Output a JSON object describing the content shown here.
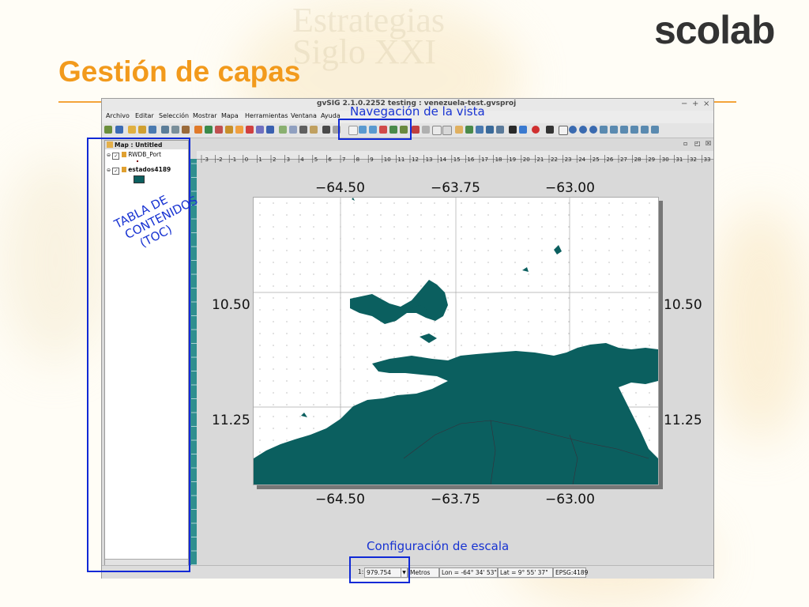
{
  "slide": {
    "title": "Gestión de capas",
    "watermark_text": "Estrategias Siglo XXI",
    "logo_text": "scolab"
  },
  "app": {
    "window_title": "gvSIG 2.1.0.2252 testing : venezuela-test.gvsproj",
    "window_controls": [
      "−",
      "+",
      "×"
    ],
    "menu": [
      "Archivo",
      "Editar",
      "Selección",
      "Mostrar",
      "Mapa",
      "Herramientas",
      "Ventana",
      "Ayuda"
    ]
  },
  "toc": {
    "title": "Map : Untitled",
    "layers": [
      {
        "name": "RWDB_Port",
        "checked": true
      },
      {
        "name": "estados4189",
        "checked": true
      }
    ],
    "legend_color": "#0b5f5f"
  },
  "view": {
    "ruler_ticks": [
      "-3",
      "-2",
      "-1",
      "0",
      "1",
      "2",
      "3",
      "4",
      "5",
      "6",
      "7",
      "8",
      "9",
      "10",
      "11",
      "12",
      "13",
      "14",
      "15",
      "16",
      "17",
      "18",
      "19",
      "20",
      "21",
      "22",
      "23",
      "24",
      "25",
      "26",
      "27",
      "28",
      "29",
      "30",
      "31",
      "32",
      "33"
    ],
    "lon_labels": [
      "−64.50",
      "−63.75",
      "−63.00"
    ],
    "lat_labels": [
      "10.50",
      "11.25"
    ],
    "land_color": "#0b5f5f"
  },
  "status": {
    "scale_prefix": "1:",
    "scale_value": "979.754",
    "units": "Metros",
    "lon": "Lon = -64° 34' 53\"",
    "lat": "Lat = 9° 55' 37\"",
    "epsg": "EPSG:4189"
  },
  "annotations": {
    "toc_label": [
      "TABLA DE",
      "CONTENIDOS",
      "(TOC)"
    ],
    "nav_label": "Navegación de la vista",
    "scale_label": "Configuración de escala",
    "highlight_color": "#1029d6"
  }
}
